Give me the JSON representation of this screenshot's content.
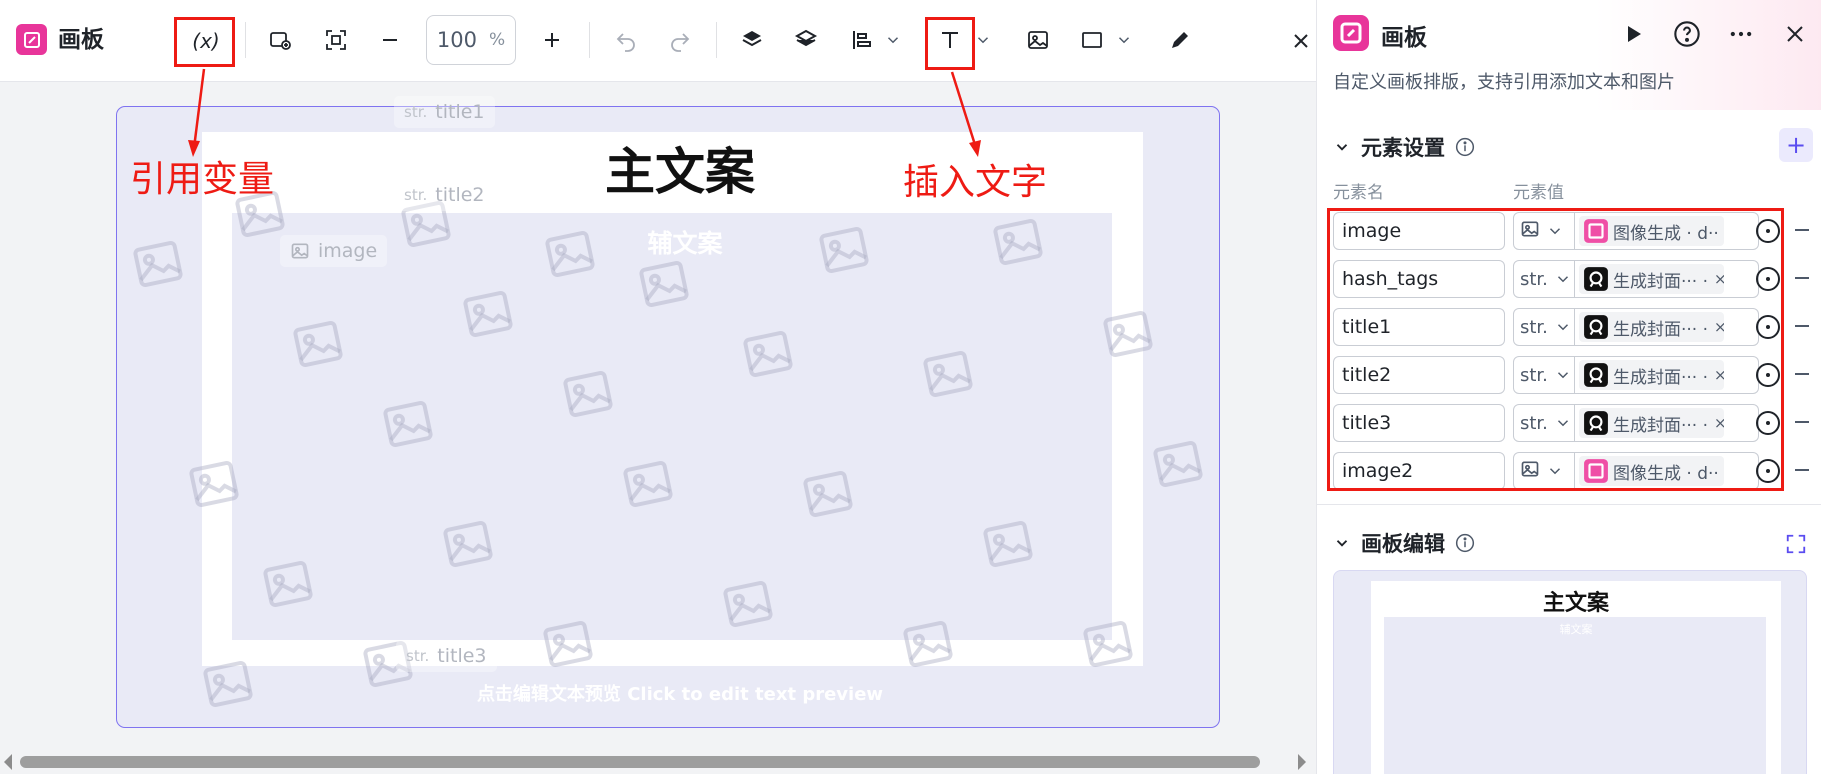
{
  "app": {
    "title": "画板"
  },
  "toolbar": {
    "zoom_value": "100",
    "zoom_unit": "%"
  },
  "annotations": {
    "reference_variable": "引用变量",
    "insert_text": "插入文字"
  },
  "canvas": {
    "main_copy": "主文案",
    "sub_copy": "辅文案",
    "preview_hint": "点击编辑文本预览 Click to edit text preview",
    "tags": [
      {
        "type": "str.",
        "name": "title1"
      },
      {
        "type": "str.",
        "name": "title2"
      },
      {
        "type": "",
        "name": "image"
      },
      {
        "type": "str.",
        "name": "title3"
      }
    ]
  },
  "panel": {
    "title": "画板",
    "description": "自定义画板排版，支持引用添加文本和图片",
    "element_section": "元素设置",
    "col_name": "元素名",
    "col_value": "元素值",
    "rows": [
      {
        "name": "image",
        "type": "image",
        "type_label": "",
        "value": "图像生成 · d··",
        "color": "#ef4fa6"
      },
      {
        "name": "hash_tags",
        "type": "str",
        "type_label": "str.",
        "value": "生成封面··· ·",
        "color": "#111111"
      },
      {
        "name": "title1",
        "type": "str",
        "type_label": "str.",
        "value": "生成封面··· ·",
        "color": "#111111"
      },
      {
        "name": "title2",
        "type": "str",
        "type_label": "str.",
        "value": "生成封面··· ·",
        "color": "#111111"
      },
      {
        "name": "title3",
        "type": "str",
        "type_label": "str.",
        "value": "生成封面··· ·",
        "color": "#111111"
      },
      {
        "name": "image2",
        "type": "image",
        "type_label": "",
        "value": "图像生成 · d··",
        "color": "#ef4fa6"
      }
    ],
    "board_section": "画板编辑",
    "mini_main_copy": "主文案",
    "mini_sub_copy": "辅文案"
  },
  "colors": {
    "accent": "#5a4cf0",
    "brand": "#e8359a",
    "annotation": "#ee1b14"
  }
}
